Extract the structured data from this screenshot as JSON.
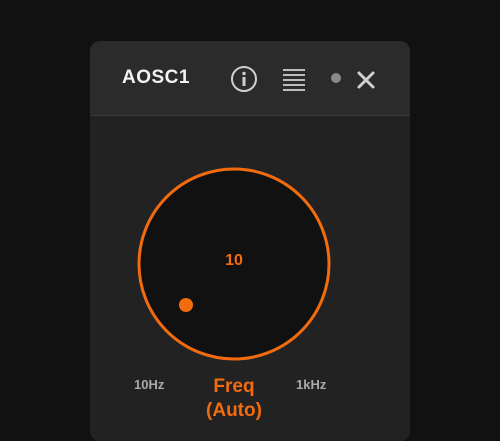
{
  "plugin": {
    "title": "AOSC1",
    "icons": {
      "info": "info-icon",
      "menu": "menu-icon",
      "status": "status-dot",
      "close": "close-icon"
    }
  },
  "knob": {
    "value": "10",
    "min_label": "10Hz",
    "max_label": "1kHz",
    "label_line1": "Freq",
    "label_line2": "(Auto)",
    "accent_color": "#f26b0f"
  },
  "colors": {
    "background": "#111111",
    "panel": "#222222",
    "header": "#2b2b2b",
    "accent": "#f26b0f",
    "muted_text": "#aaaaaa"
  }
}
